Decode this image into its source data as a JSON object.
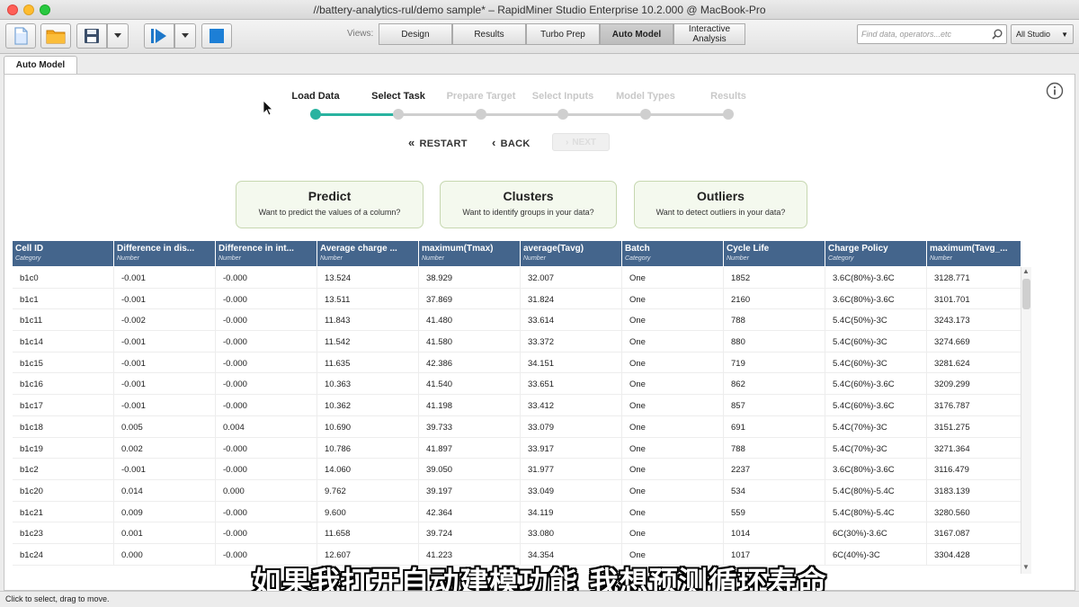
{
  "window": {
    "title": "//battery-analytics-rul/demo sample* – RapidMiner Studio Enterprise 10.2.000 @ MacBook-Pro"
  },
  "toolbar": {
    "views_label": "Views:",
    "views": [
      {
        "label": "Design"
      },
      {
        "label": "Results"
      },
      {
        "label": "Turbo Prep"
      },
      {
        "label": "Auto Model",
        "active": true
      },
      {
        "label": "Interactive Analysis"
      }
    ],
    "search_placeholder": "Find data, operators...etc",
    "studio_select": "All Studio"
  },
  "panel": {
    "tab_label": "Auto Model"
  },
  "stepper": {
    "steps": [
      {
        "label": "Load Data",
        "state": "done"
      },
      {
        "label": "Select Task",
        "state": "current"
      },
      {
        "label": "Prepare Target",
        "state": "pending"
      },
      {
        "label": "Select Inputs",
        "state": "pending"
      },
      {
        "label": "Model Types",
        "state": "pending"
      },
      {
        "label": "Results",
        "state": "pending"
      }
    ],
    "accent_color": "#2ab3a0"
  },
  "nav": {
    "restart": "RESTART",
    "back": "BACK",
    "next": "NEXT"
  },
  "tasks": [
    {
      "title": "Predict",
      "subtitle": "Want to predict the values of a column?"
    },
    {
      "title": "Clusters",
      "subtitle": "Want to identify groups in your data?"
    },
    {
      "title": "Outliers",
      "subtitle": "Want to detect outliers in your data?"
    }
  ],
  "table": {
    "columns": [
      {
        "name": "Cell ID",
        "type": "Category"
      },
      {
        "name": "Difference in dis...",
        "type": "Number"
      },
      {
        "name": "Difference in int...",
        "type": "Number"
      },
      {
        "name": "Average charge ...",
        "type": "Number"
      },
      {
        "name": "maximum(Tmax)",
        "type": "Number"
      },
      {
        "name": "average(Tavg)",
        "type": "Number"
      },
      {
        "name": "Batch",
        "type": "Category"
      },
      {
        "name": "Cycle Life",
        "type": "Number"
      },
      {
        "name": "Charge Policy",
        "type": "Category"
      },
      {
        "name": "maximum(Tavg_...",
        "type": "Number"
      }
    ],
    "rows": [
      [
        "b1c0",
        "-0.001",
        "-0.000",
        "13.524",
        "38.929",
        "32.007",
        "One",
        "1852",
        "3.6C(80%)-3.6C",
        "3128.771"
      ],
      [
        "b1c1",
        "-0.001",
        "-0.000",
        "13.511",
        "37.869",
        "31.824",
        "One",
        "2160",
        "3.6C(80%)-3.6C",
        "3101.701"
      ],
      [
        "b1c11",
        "-0.002",
        "-0.000",
        "11.843",
        "41.480",
        "33.614",
        "One",
        "788",
        "5.4C(50%)-3C",
        "3243.173"
      ],
      [
        "b1c14",
        "-0.001",
        "-0.000",
        "11.542",
        "41.580",
        "33.372",
        "One",
        "880",
        "5.4C(60%)-3C",
        "3274.669"
      ],
      [
        "b1c15",
        "-0.001",
        "-0.000",
        "11.635",
        "42.386",
        "34.151",
        "One",
        "719",
        "5.4C(60%)-3C",
        "3281.624"
      ],
      [
        "b1c16",
        "-0.001",
        "-0.000",
        "10.363",
        "41.540",
        "33.651",
        "One",
        "862",
        "5.4C(60%)-3.6C",
        "3209.299"
      ],
      [
        "b1c17",
        "-0.001",
        "-0.000",
        "10.362",
        "41.198",
        "33.412",
        "One",
        "857",
        "5.4C(60%)-3.6C",
        "3176.787"
      ],
      [
        "b1c18",
        "0.005",
        "0.004",
        "10.690",
        "39.733",
        "33.079",
        "One",
        "691",
        "5.4C(70%)-3C",
        "3151.275"
      ],
      [
        "b1c19",
        "0.002",
        "-0.000",
        "10.786",
        "41.897",
        "33.917",
        "One",
        "788",
        "5.4C(70%)-3C",
        "3271.364"
      ],
      [
        "b1c2",
        "-0.001",
        "-0.000",
        "14.060",
        "39.050",
        "31.977",
        "One",
        "2237",
        "3.6C(80%)-3.6C",
        "3116.479"
      ],
      [
        "b1c20",
        "0.014",
        "0.000",
        "9.762",
        "39.197",
        "33.049",
        "One",
        "534",
        "5.4C(80%)-5.4C",
        "3183.139"
      ],
      [
        "b1c21",
        "0.009",
        "-0.000",
        "9.600",
        "42.364",
        "34.119",
        "One",
        "559",
        "5.4C(80%)-5.4C",
        "3280.560"
      ],
      [
        "b1c23",
        "0.001",
        "-0.000",
        "11.658",
        "39.724",
        "33.080",
        "One",
        "1014",
        "6C(30%)-3.6C",
        "3167.087"
      ],
      [
        "b1c24",
        "0.000",
        "-0.000",
        "12.607",
        "41.223",
        "34.354",
        "One",
        "1017",
        "6C(40%)-3C",
        "3304.428"
      ]
    ]
  },
  "subtitle": "如果我打开自动建模功能 我想预测循环寿命",
  "status": "Click to select, drag to move."
}
